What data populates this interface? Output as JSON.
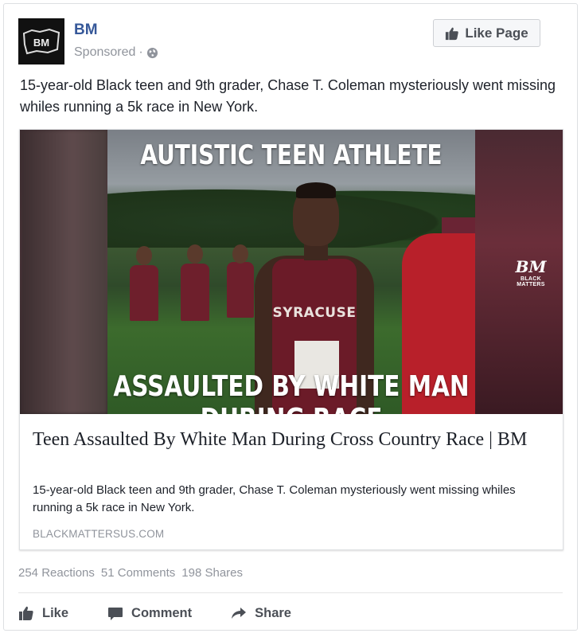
{
  "post": {
    "page_name": "BM",
    "avatar_text": "BM",
    "sponsored_label": "Sponsored",
    "separator": "·",
    "like_page_label": "Like Page",
    "text": "15-year-old Black teen and 9th grader, Chase T. Coleman mysteriously went missing whiles running a 5k race in New York."
  },
  "link_preview": {
    "image": {
      "headline_top": "AUTISTIC TEEN ATHLETE",
      "headline_bottom": "ASSAULTED BY WHITE MAN DURING RACE",
      "watermark_mark": "BM",
      "watermark_sub": "BLACK MATTERS",
      "jersey_text": "SYRACUSE"
    },
    "title": "Teen Assaulted By White Man During Cross Country Race | BM",
    "description": "15-year-old Black teen and 9th grader, Chase T. Coleman mysteriously went missing whiles running a 5k race in New York.",
    "domain": "BLACKMATTERSUS.COM"
  },
  "stats": {
    "reactions": "254 Reactions",
    "comments": "51 Comments",
    "shares": "198 Shares"
  },
  "actions": {
    "like": "Like",
    "comment": "Comment",
    "share": "Share"
  },
  "icons": {
    "globe": "globe-icon",
    "thumbs_up": "thumbs-up-icon",
    "comment": "comment-icon",
    "share": "share-arrow-icon"
  },
  "colors": {
    "page_name": "#365899",
    "muted": "#90949c",
    "action_text": "#4b4f56",
    "border": "#dddfe2"
  }
}
